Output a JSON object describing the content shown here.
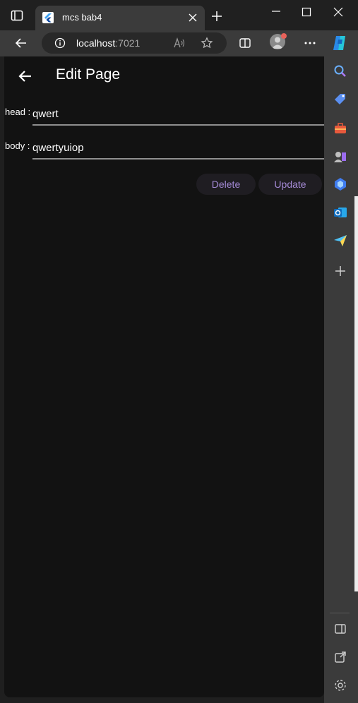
{
  "browser": {
    "tab_title": "mcs bab4",
    "url_host": "localhost",
    "url_port": ":7021"
  },
  "sidebar_icons": [
    "search-icon",
    "shopping-tag-icon",
    "tools-icon",
    "games-icon",
    "copilot-icon",
    "outlook-icon",
    "send-icon",
    "add-icon",
    "split-sidebar-icon",
    "external-link-icon",
    "settings-icon"
  ],
  "app": {
    "title": "Edit Page",
    "fields": {
      "head_label": "head :",
      "head_value": "qwert",
      "body_label": "body :",
      "body_value": "qwertyuiop"
    },
    "buttons": {
      "delete_label": "Delete",
      "update_label": "Update"
    }
  },
  "colors": {
    "accent": "#a48ad6",
    "surface": "#121212",
    "chrome": "#3b3b3b"
  }
}
